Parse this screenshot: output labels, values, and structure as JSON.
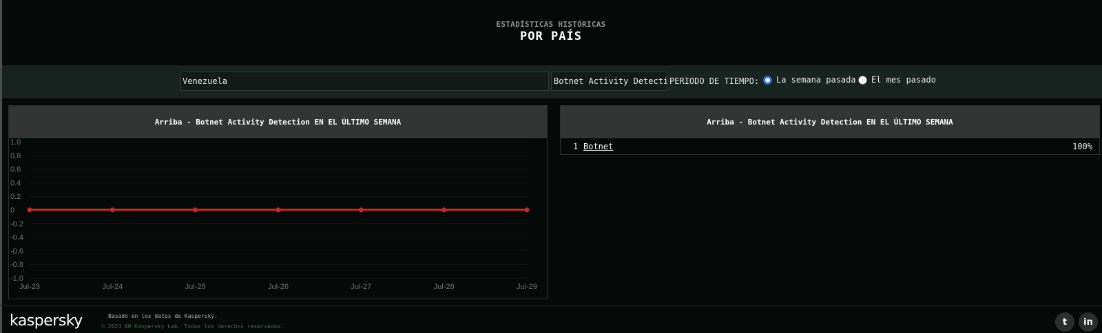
{
  "header": {
    "kicker": "ESTADÍSTICAS HISTÓRICAS",
    "title": "POR PAÍS"
  },
  "filters": {
    "country_value": "Venezuela",
    "detection_type": "Botnet Activity Detection",
    "period_label": "PERIODO DE TIEMPO:",
    "period_options": [
      {
        "label": "La semana pasada",
        "checked": true
      },
      {
        "label": "El mes pasado",
        "checked": false
      }
    ]
  },
  "chart_panel": {
    "heading": "Arriba - Botnet Activity Detection EN EL ÚLTIMO SEMANA"
  },
  "top_panel": {
    "heading": "Arriba - Botnet Activity Detection EN EL ÚLTIMO SEMANA",
    "rows": [
      {
        "rank": "1",
        "name": "Botnet",
        "percent": "100%"
      }
    ]
  },
  "chart_data": {
    "type": "line",
    "x": [
      "Jul-23",
      "Jul-24",
      "Jul-25",
      "Jul-26",
      "Jul-27",
      "Jul-28",
      "Jul-29"
    ],
    "series": [
      {
        "values": [
          0,
          0,
          0,
          0,
          0,
          0,
          0
        ],
        "color": "#c8281e"
      }
    ],
    "ylim": [
      -1.0,
      1.0
    ],
    "yticks": [
      "1.0",
      "0.8",
      "0.6",
      "0.4",
      "0.2",
      "0",
      "-0.2",
      "-0.4",
      "-0.6",
      "-0.8",
      "-1.0"
    ],
    "grid": true
  },
  "footer": {
    "logo": "kaspersky",
    "note": "Basado en los datos de Kaspersky.",
    "copyright": "© 2024 AO Kaspersky Lab. Todos los derechos reservados.",
    "twitter_icon": "t",
    "linkedin_icon": "in"
  },
  "colors": {
    "background": "#050a08",
    "toolbar": "#17231e",
    "panel_header": "#333535",
    "line": "#c8281e",
    "radio_accent": "#1a73e8"
  }
}
